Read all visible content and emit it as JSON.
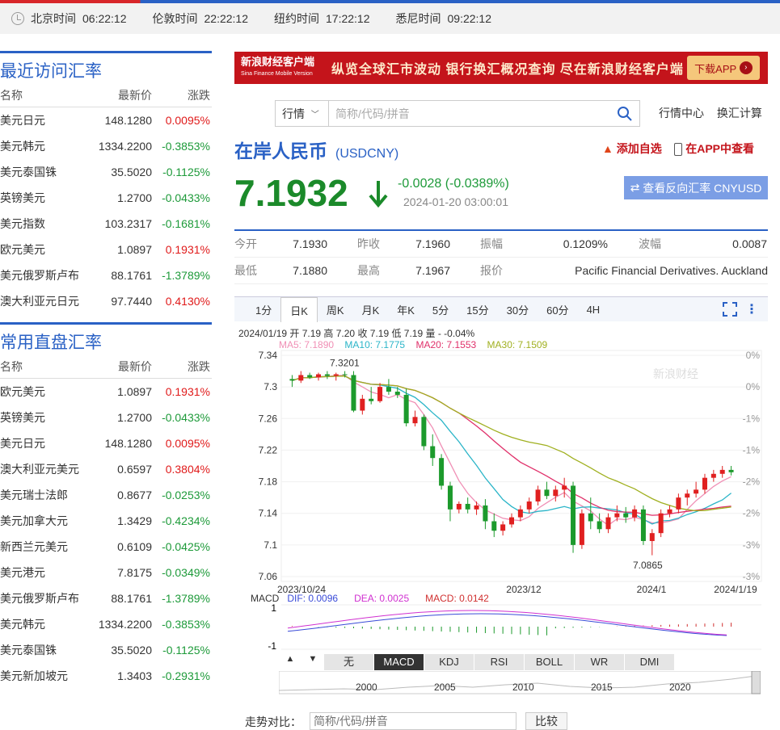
{
  "timebar": [
    {
      "city": "北京时间",
      "time": "06:22:12"
    },
    {
      "city": "伦敦时间",
      "time": "22:22:12"
    },
    {
      "city": "纽约时间",
      "time": "17:22:12"
    },
    {
      "city": "悉尼时间",
      "time": "09:22:12"
    }
  ],
  "recent": {
    "title": "最近访问汇率",
    "headers": [
      "名称",
      "最新价",
      "涨跌"
    ],
    "rows": [
      [
        "美元日元",
        "148.1280",
        "0.0095%",
        "up"
      ],
      [
        "美元韩元",
        "1334.2200",
        "-0.3853%",
        "dn"
      ],
      [
        "美元泰国铢",
        "35.5020",
        "-0.1125%",
        "dn"
      ],
      [
        "英镑美元",
        "1.2700",
        "-0.0433%",
        "dn"
      ],
      [
        "美元指数",
        "103.2317",
        "-0.1681%",
        "dn"
      ],
      [
        "欧元美元",
        "1.0897",
        "0.1931%",
        "up"
      ],
      [
        "美元俄罗斯卢布",
        "88.1761",
        "-1.3789%",
        "dn"
      ],
      [
        "澳大利亚元日元",
        "97.7440",
        "0.4130%",
        "up"
      ]
    ]
  },
  "common": {
    "title": "常用直盘汇率",
    "headers": [
      "名称",
      "最新价",
      "涨跌"
    ],
    "rows": [
      [
        "欧元美元",
        "1.0897",
        "0.1931%",
        "up"
      ],
      [
        "英镑美元",
        "1.2700",
        "-0.0433%",
        "dn"
      ],
      [
        "美元日元",
        "148.1280",
        "0.0095%",
        "up"
      ],
      [
        "澳大利亚元美元",
        "0.6597",
        "0.3804%",
        "up"
      ],
      [
        "美元瑞士法郎",
        "0.8677",
        "-0.0253%",
        "dn"
      ],
      [
        "美元加拿大元",
        "1.3429",
        "-0.4234%",
        "dn"
      ],
      [
        "新西兰元美元",
        "0.6109",
        "-0.0425%",
        "dn"
      ],
      [
        "美元港元",
        "7.8175",
        "-0.0349%",
        "dn"
      ],
      [
        "美元俄罗斯卢布",
        "88.1761",
        "-1.3789%",
        "dn"
      ],
      [
        "美元韩元",
        "1334.2200",
        "-0.3853%",
        "dn"
      ],
      [
        "美元泰国铢",
        "35.5020",
        "-0.1125%",
        "dn"
      ],
      [
        "美元新加坡元",
        "1.3403",
        "-0.2931%",
        "dn"
      ]
    ]
  },
  "banner": {
    "logo": "新浪财经客户端",
    "logo_sub": "Sina Finance Mobile Version",
    "text": "纵览全球汇市波动  银行换汇概况查询  尽在新浪财经客户端",
    "btn": "下载APP"
  },
  "search": {
    "select": "行情",
    "placeholder": "简称/代码/拼音",
    "links": [
      "行情中心",
      "换汇计算"
    ]
  },
  "symbol": {
    "name": "在岸人民币",
    "code": "(USDCNY)",
    "fav": "添加自选",
    "app": "在APP中查看"
  },
  "quote": {
    "price": "7.1932",
    "change": "-0.0028 (-0.0389%)",
    "time": "2024-01-20 03:00:01",
    "reverse": "查看反向汇率 CNYUSD",
    "rows": [
      [
        [
          "今开",
          "7.1930"
        ],
        [
          "昨收",
          "7.1960"
        ],
        [
          "振幅",
          "0.1209%"
        ],
        [
          "波幅",
          "0.0087"
        ]
      ],
      [
        [
          "最低",
          "7.1880"
        ],
        [
          "最高",
          "7.1967"
        ],
        [
          "报价",
          "Pacific Financial Derivatives. Auckland"
        ]
      ]
    ]
  },
  "tabs": [
    "1分",
    "日K",
    "周K",
    "月K",
    "年K",
    "5分",
    "15分",
    "30分",
    "60分",
    "4H"
  ],
  "chart_info": {
    "line1": "2024/01/19 开 7.19 高 7.20 收 7.19 低 7.19 量 - -0.04%",
    "ma5": "MA5: 7.1890",
    "ma10": "MA10: 7.1775",
    "ma20": "MA20: 7.1553",
    "ma30": "MA30: 7.1509",
    "macd": "MACD",
    "dif": "DIF: 0.0096",
    "dea": "DEA: 0.0025",
    "macdv": "MACD: 0.0142",
    "watermark": "新浪财经",
    "hi_label": "7.3201",
    "lo_label": "7.0865"
  },
  "chart_data": {
    "type": "candlestick",
    "ylim": [
      7.06,
      7.34
    ],
    "yticks": [
      "7.34",
      "7.3",
      "7.26",
      "7.22",
      "7.18",
      "7.14",
      "7.1",
      "7.06"
    ],
    "pct_ticks": [
      "0%",
      "0%",
      "-1%",
      "-1%",
      "-2%",
      "-2%",
      "-3%",
      "-3%"
    ],
    "xticks": [
      "2023/10/24",
      "2023/12",
      "2024/1",
      "2024/1/19"
    ],
    "candles": [
      [
        7.31,
        7.315,
        7.3,
        7.308
      ],
      [
        7.308,
        7.32,
        7.305,
        7.315
      ],
      [
        7.315,
        7.318,
        7.31,
        7.312
      ],
      [
        7.312,
        7.318,
        7.308,
        7.316
      ],
      [
        7.316,
        7.32,
        7.31,
        7.314
      ],
      [
        7.314,
        7.318,
        7.308,
        7.316
      ],
      [
        7.316,
        7.32,
        7.312,
        7.315
      ],
      [
        7.315,
        7.32,
        7.268,
        7.27
      ],
      [
        7.27,
        7.29,
        7.265,
        7.285
      ],
      [
        7.285,
        7.3,
        7.278,
        7.282
      ],
      [
        7.282,
        7.305,
        7.28,
        7.3
      ],
      [
        7.3,
        7.31,
        7.29,
        7.294
      ],
      [
        7.294,
        7.3,
        7.286,
        7.29
      ],
      [
        7.29,
        7.298,
        7.25,
        7.254
      ],
      [
        7.254,
        7.27,
        7.25,
        7.262
      ],
      [
        7.262,
        7.265,
        7.22,
        7.225
      ],
      [
        7.225,
        7.24,
        7.2,
        7.21
      ],
      [
        7.21,
        7.215,
        7.17,
        7.175
      ],
      [
        7.175,
        7.18,
        7.13,
        7.145
      ],
      [
        7.145,
        7.155,
        7.14,
        7.152
      ],
      [
        7.152,
        7.16,
        7.14,
        7.145
      ],
      [
        7.145,
        7.155,
        7.138,
        7.15
      ],
      [
        7.15,
        7.158,
        7.12,
        7.13
      ],
      [
        7.13,
        7.14,
        7.11,
        7.118
      ],
      [
        7.118,
        7.13,
        7.112,
        7.126
      ],
      [
        7.126,
        7.14,
        7.122,
        7.135
      ],
      [
        7.135,
        7.15,
        7.13,
        7.145
      ],
      [
        7.145,
        7.16,
        7.14,
        7.155
      ],
      [
        7.155,
        7.175,
        7.15,
        7.17
      ],
      [
        7.17,
        7.18,
        7.158,
        7.162
      ],
      [
        7.162,
        7.175,
        7.155,
        7.17
      ],
      [
        7.17,
        7.185,
        7.16,
        7.175
      ],
      [
        7.175,
        7.18,
        7.09,
        7.1
      ],
      [
        7.1,
        7.145,
        7.095,
        7.14
      ],
      [
        7.14,
        7.16,
        7.12,
        7.13
      ],
      [
        7.13,
        7.14,
        7.115,
        7.12
      ],
      [
        7.12,
        7.14,
        7.115,
        7.135
      ],
      [
        7.135,
        7.15,
        7.13,
        7.14
      ],
      [
        7.14,
        7.148,
        7.128,
        7.135
      ],
      [
        7.135,
        7.15,
        7.13,
        7.145
      ],
      [
        7.145,
        7.15,
        7.1,
        7.105
      ],
      [
        7.105,
        7.12,
        7.087,
        7.115
      ],
      [
        7.115,
        7.145,
        7.11,
        7.14
      ],
      [
        7.14,
        7.15,
        7.135,
        7.145
      ],
      [
        7.145,
        7.165,
        7.14,
        7.16
      ],
      [
        7.16,
        7.17,
        7.15,
        7.165
      ],
      [
        7.165,
        7.18,
        7.16,
        7.17
      ],
      [
        7.17,
        7.19,
        7.165,
        7.185
      ],
      [
        7.185,
        7.195,
        7.18,
        7.19
      ],
      [
        7.19,
        7.2,
        7.185,
        7.195
      ],
      [
        7.195,
        7.2,
        7.188,
        7.192
      ]
    ]
  },
  "indicator_tabs": [
    "无",
    "MACD",
    "KDJ",
    "RSI",
    "BOLL",
    "WR",
    "DMI"
  ],
  "timeline": [
    "2000",
    "2005",
    "2010",
    "2015",
    "2020"
  ],
  "compare": {
    "label": "走势对比：",
    "placeholder": "简称/代码/拼音",
    "btn": "比较"
  }
}
